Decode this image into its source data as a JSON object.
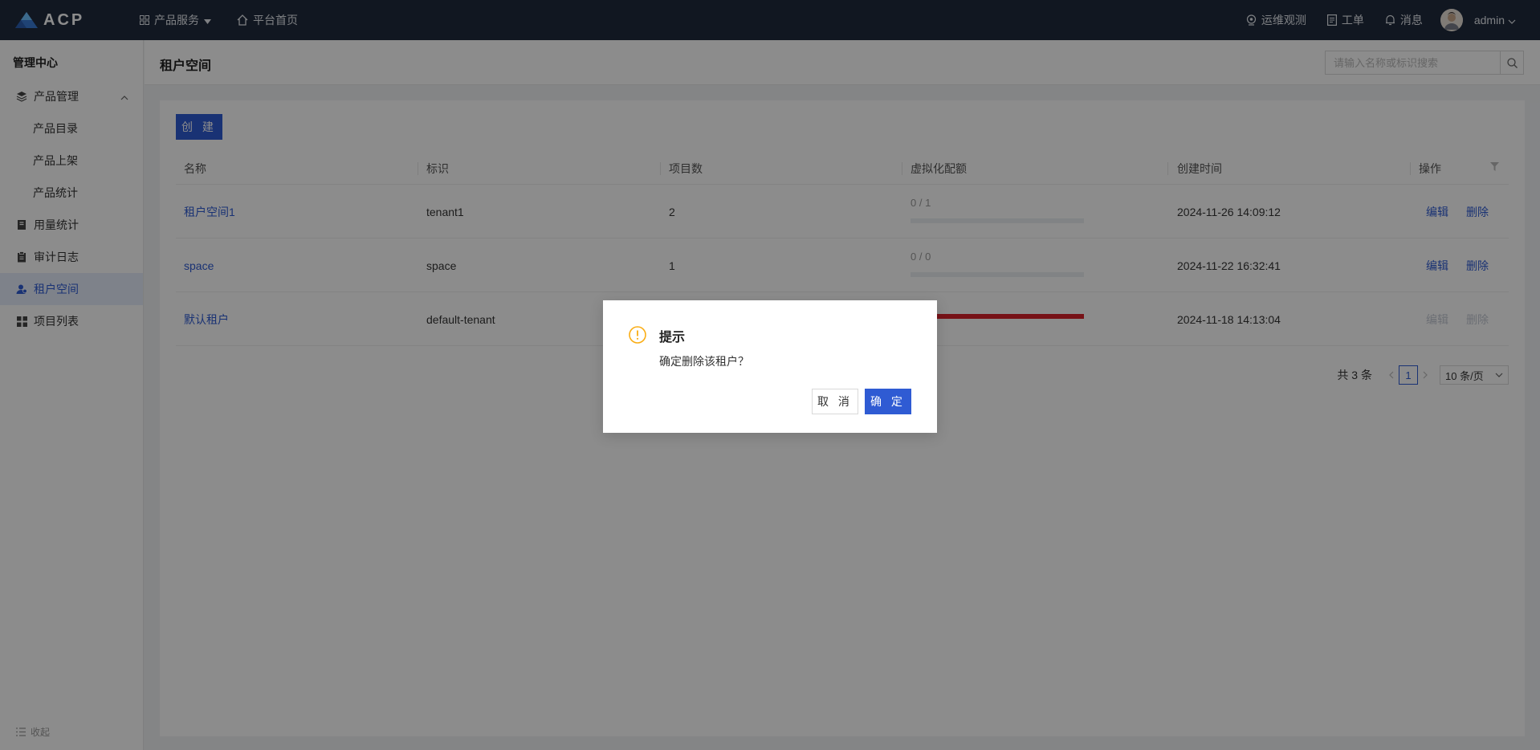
{
  "topbar": {
    "logo_text": "ACP",
    "nav": [
      {
        "label": "产品服务",
        "icon": "grid-icon"
      },
      {
        "label": "平台首页",
        "icon": "home-icon"
      }
    ],
    "right_nav": [
      {
        "label": "运维观测",
        "icon": "monitor-icon"
      },
      {
        "label": "工单",
        "icon": "ticket-icon"
      },
      {
        "label": "消息",
        "icon": "bell-icon"
      }
    ],
    "user": "admin"
  },
  "sidebar": {
    "title": "管理中心",
    "items": [
      {
        "label": "产品管理",
        "icon": "layers-icon"
      },
      {
        "label": "产品目录"
      },
      {
        "label": "产品上架"
      },
      {
        "label": "产品统计"
      },
      {
        "label": "用量统计",
        "icon": "book-icon"
      },
      {
        "label": "审计日志",
        "icon": "clipboard-icon"
      },
      {
        "label": "租户空间",
        "icon": "user-group-icon"
      },
      {
        "label": "项目列表",
        "icon": "apps-icon"
      }
    ],
    "collapse_label": "收起"
  },
  "page": {
    "title": "租户空间",
    "search_placeholder": "请输入名称或标识搜索"
  },
  "toolbar": {
    "create_label": "创 建"
  },
  "table": {
    "columns": [
      "名称",
      "标识",
      "项目数",
      "虚拟化配额",
      "创建时间",
      "操作"
    ],
    "rows": [
      {
        "name": "租户空间1",
        "id": "tenant1",
        "projects": "2",
        "quota": "0 / 1",
        "quota_fraction": 0,
        "created": "2024-11-26 14:09:12",
        "edit": "编辑",
        "delete": "删除"
      },
      {
        "name": "space",
        "id": "space",
        "projects": "1",
        "quota": "0 / 0",
        "quota_fraction": 0,
        "created": "2024-11-22 16:32:41",
        "edit": "编辑",
        "delete": "删除"
      },
      {
        "name": "默认租户",
        "id": "default-tenant",
        "projects": "",
        "quota": "",
        "quota_fraction": 1,
        "created": "2024-11-18 14:13:04",
        "edit": "编辑",
        "delete": "删除"
      }
    ]
  },
  "pagination": {
    "total": "共 3 条",
    "current": "1",
    "page_size": "10 条/页"
  },
  "modal": {
    "title": "提示",
    "message": "确定删除该租户？",
    "cancel_label": "取 消",
    "ok_label": "确 定"
  },
  "colors": {
    "accent": "#2f5bd3",
    "topbar": "#1f2a3c",
    "danger": "#d9222a",
    "warning": "#faad14"
  }
}
